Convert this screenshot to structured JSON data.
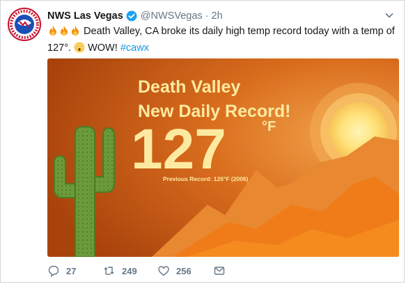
{
  "account": {
    "name": "NWS Las Vegas",
    "handle": "@NWSVegas",
    "separator": "·",
    "time": "2h",
    "verified": true,
    "logo_text": "NATIONAL WEATHER SERVICE"
  },
  "tweet": {
    "emoji_prefix": [
      "fire",
      "fire",
      "fire"
    ],
    "text_main": "Death Valley, CA broke its daily high temp record today with a temp of 127°.",
    "emoji_mid": "astonished-face",
    "text_end": "WOW!",
    "hashtag": "#cawx"
  },
  "media": {
    "line1": "Death Valley",
    "line2": "New Daily Record!",
    "temp": "127",
    "unit": "°F",
    "previous": "Previous Record: 126°F (2006)"
  },
  "actions": {
    "reply_count": "27",
    "retweet_count": "249",
    "like_count": "256"
  },
  "colors": {
    "accent": "#1b95e0",
    "verified": "#1da1f2",
    "muted": "#657786",
    "poster_bg": "#c45a12",
    "poster_text": "#fdeaa0",
    "cactus": "#6b9a3a"
  }
}
